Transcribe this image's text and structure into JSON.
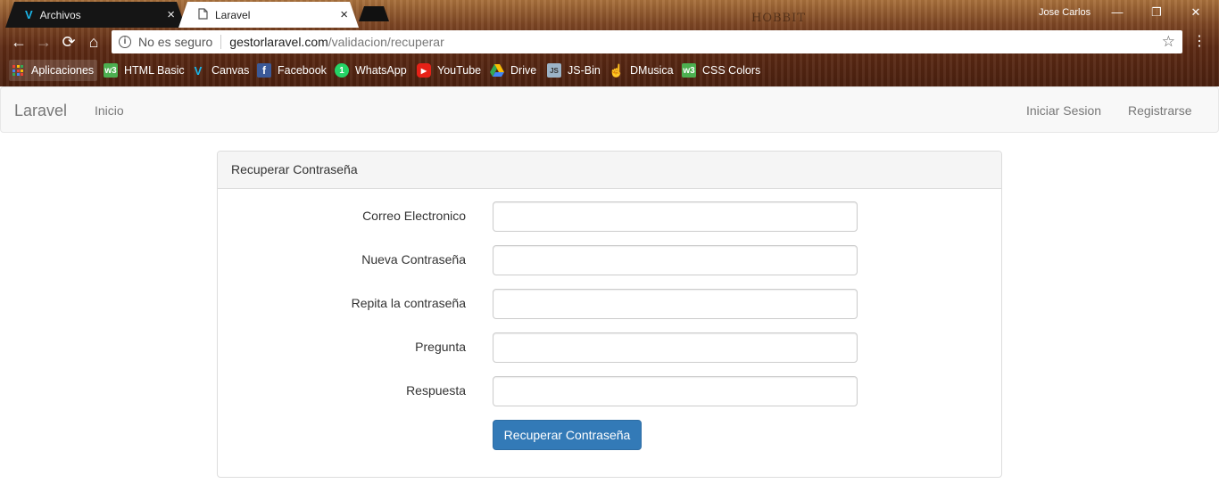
{
  "browser": {
    "tabs": [
      {
        "label": "Archivos",
        "active": false
      },
      {
        "label": "Laravel",
        "active": true
      }
    ],
    "user": "Jose Carlos",
    "window_controls": {
      "minimize": "—",
      "maximize": "❐",
      "close": "✕"
    },
    "address": {
      "security": "No es seguro",
      "domain": "gestorlaravel.com",
      "path": "/validacion/recuperar"
    },
    "bookmarks": [
      {
        "label": "Aplicaciones",
        "icon": "apps-icon"
      },
      {
        "label": "HTML Basic",
        "icon": "w3-icon"
      },
      {
        "label": "Canvas",
        "icon": "vimeo-icon"
      },
      {
        "label": "Facebook",
        "icon": "facebook-icon"
      },
      {
        "label": "WhatsApp",
        "icon": "whatsapp-icon"
      },
      {
        "label": "YouTube",
        "icon": "youtube-icon"
      },
      {
        "label": "Drive",
        "icon": "drive-icon"
      },
      {
        "label": "JS-Bin",
        "icon": "jsbin-icon"
      },
      {
        "label": "DMusica",
        "icon": "hand-icon"
      },
      {
        "label": "CSS Colors",
        "icon": "w3-icon"
      }
    ]
  },
  "navbar": {
    "brand": "Laravel",
    "left_links": [
      "Inicio"
    ],
    "right_links": [
      "Iniciar Sesion",
      "Registrarse"
    ]
  },
  "form": {
    "heading": "Recuperar Contraseña",
    "fields": [
      {
        "label": "Correo Electronico",
        "value": ""
      },
      {
        "label": "Nueva Contraseña",
        "value": ""
      },
      {
        "label": "Repita la contraseña",
        "value": ""
      },
      {
        "label": "Pregunta",
        "value": ""
      },
      {
        "label": "Respuesta",
        "value": ""
      }
    ],
    "submit_label": "Recuperar Contraseña"
  },
  "colors": {
    "primary_button": "#337ab7",
    "navbar_bg": "#f8f8f8",
    "panel_heading_bg": "#f5f5f5"
  }
}
